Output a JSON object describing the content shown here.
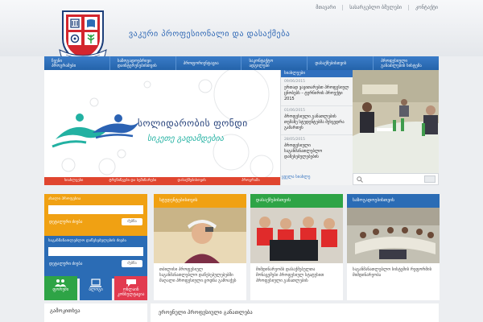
{
  "header": {
    "top_links": [
      "მთავარი",
      "სასარგებლო ბმულები",
      "კონტაქტი"
    ],
    "site_title": "ვაკური პროფესიონალი და დასაქმება"
  },
  "nav": [
    {
      "l1": "ჩვენი",
      "l2": "პროგრამები"
    },
    {
      "l1": "საზოგადოებრივი",
      "l2": "დაინტერესებისთვის"
    },
    {
      "l1": "პროფორიენტაცია",
      "l2": ""
    },
    {
      "l1": "საკონტაქტო",
      "l2": "ადგილები"
    },
    {
      "l1": "დასაქმებისთვის",
      "l2": ""
    },
    {
      "l1": "პროფესიული",
      "l2": "განათლების სისტემა"
    }
  ],
  "banner": {
    "headline": "სოლიდარობის ფონდი",
    "tagline": "სიკეთე გადამდებია",
    "tabs": [
      "სიახლეები",
      "ტრენინგები და სემინარები",
      "დასაქმებისთვის",
      "პროგრამა"
    ]
  },
  "news": {
    "heading": "სიახლეები",
    "items": [
      {
        "date": "09/06/2015",
        "title": "ერთად ვავითარებთ პროფესიულ ცნობებს – ტურნირის პროექტი 2015"
      },
      {
        "date": "01/06/2015",
        "title": "პროფესიული განათლების თემაზე სტუდენტებმა შეხვედრა გამართეს"
      },
      {
        "date": "28/05/2015",
        "title": "პროფესიული საგანმანათლებლო დაწესებულებების"
      }
    ],
    "more": "ყველა სიახლე"
  },
  "search": {
    "placeholder": ""
  },
  "widgets": [
    {
      "title": "ახალი პროფესია",
      "label": "დეტალური ძიება",
      "button": "ძებნა",
      "color": "#f0a113"
    },
    {
      "title": "საგანმანათლებლო დაწესებულების ძიება",
      "label": "დეტალური ძიება",
      "button": "ძებნა",
      "color": "#2b6cb5"
    }
  ],
  "minis": [
    {
      "label": "ფორუმი",
      "icon": "people-icon",
      "color": "#2ea446"
    },
    {
      "label": "ბლოგი",
      "icon": "computer-icon",
      "color": "#2b6cb5"
    },
    {
      "label": "ონლაინ კონსულტაცია",
      "icon": "chat-icon",
      "color": "#e23b4f"
    }
  ],
  "cards": [
    {
      "title": "სტუდენტებისთვის",
      "text": "თბილისი პროფესიულ საგანმანათლებლო დაწესებულებებში მაღალი პროფესიული ცოდნა გამოაქვს",
      "color": "#f0a113"
    },
    {
      "title": "დასაქმებისთვის",
      "text": "მიმდინარეობს დასაქმებულთა მონაცემები პროფესიულ სტატუსით პროფესიული განათლების",
      "color": "#2ea446"
    },
    {
      "title": "საზოგადოებისთვის",
      "text": "საგანმანათლებლო სისტემის რეფორმის მიმდინარეობა",
      "color": "#2b6cb5"
    }
  ],
  "bottom": {
    "left_title": "გამოკითხვა",
    "wide_title": "ეროვნული პროფესიული განათლება"
  }
}
